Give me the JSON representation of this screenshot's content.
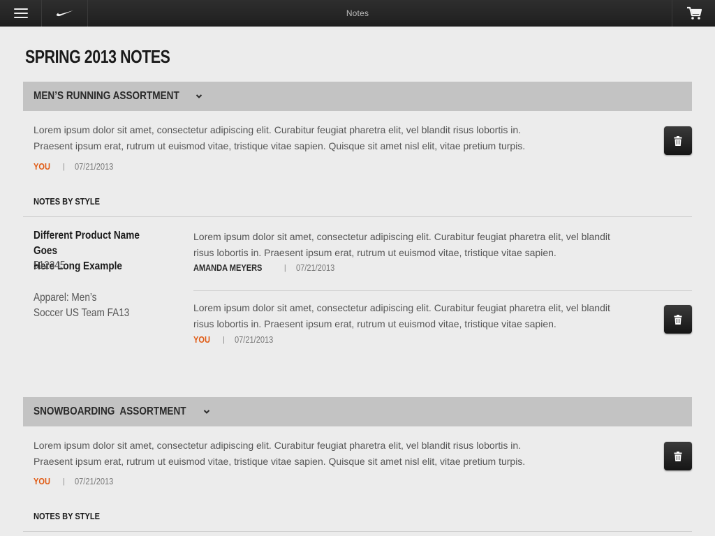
{
  "topbar": {
    "title": "Notes",
    "menu_icon": "hamburger-icon",
    "logo_icon": "swoosh-logo",
    "cart_icon": "cart-icon"
  },
  "page_title": "SPRING 2013 NOTES",
  "sections": [
    {
      "header": "MEN’S RUNNING ASSORTMENT",
      "note": {
        "line1": "Lorem ipsum dolor sit amet, consectetur adipiscing elit. Curabitur feugiat pharetra elit, vel blandit risus lobortis in.",
        "line2": "Praesent ipsum erat, rutrum ut euismod vitae, tristique vitae sapien. Quisque sit amet nisl elit, vitae pretium turpis.",
        "author": "YOU",
        "date": "07/21/2013"
      },
      "notes_by_style_label": "NOTES BY STYLE",
      "style": {
        "name_line1": "Different Product Name Goes",
        "name_line2": "Here Long Example",
        "id": "512345",
        "category_line1": "Apparel: Men’s",
        "category_line2": "Soccer US Team FA13",
        "notes": [
          {
            "line1": "Lorem ipsum dolor sit amet, consectetur adipiscing elit. Curabitur feugiat pharetra elit, vel blandit",
            "line2": "risus lobortis in. Praesent ipsum erat, rutrum ut euismod vitae, tristique vitae sapien.",
            "author": "AMANDA MEYERS",
            "date": "07/21/2013"
          },
          {
            "line1": "Lorem ipsum dolor sit amet, consectetur adipiscing elit. Curabitur feugiat pharetra elit, vel blandit",
            "line2": "risus lobortis in. Praesent ipsum erat, rutrum ut euismod vitae, tristique vitae sapien.",
            "author": "YOU",
            "date": "07/21/2013"
          }
        ]
      }
    },
    {
      "header": "SNOWBOARDING  ASSORTMENT",
      "note": {
        "line1": "Lorem ipsum dolor sit amet, consectetur adipiscing elit. Curabitur feugiat pharetra elit, vel blandit risus lobortis in.",
        "line2": "Praesent ipsum erat, rutrum ut euismod vitae, tristique vitae sapien. Quisque sit amet nisl elit, vitae pretium turpis.",
        "author": "YOU",
        "date": "07/21/2013"
      },
      "notes_by_style_label": "NOTES BY STYLE"
    }
  ],
  "colors": {
    "accent_you": "#e05a13",
    "header_band": "#c3c3c3",
    "topbar": "#262626"
  }
}
